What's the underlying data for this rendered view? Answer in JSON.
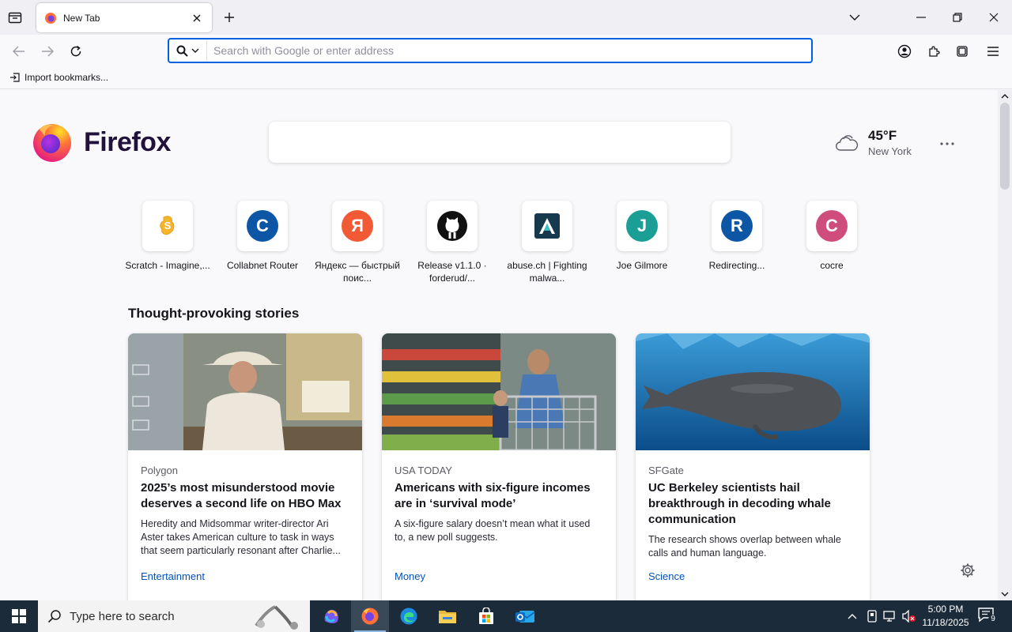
{
  "browser": {
    "tab": {
      "title": "New Tab"
    },
    "urlbar": {
      "placeholder": "Search with Google or enter address"
    },
    "bookmarks": {
      "import_label": "Import bookmarks..."
    }
  },
  "newtab": {
    "brand": "Firefox",
    "weather": {
      "temp": "45°F",
      "city": "New York"
    },
    "topsites": [
      {
        "label": "Scratch - Imagine,...",
        "letter": "",
        "color": "#f6b32c"
      },
      {
        "label": "Collabnet Router",
        "letter": "C",
        "color": "#0d56a6"
      },
      {
        "label": "Яндекс — быстрый поис...",
        "letter": "Я",
        "color": "#f25a36"
      },
      {
        "label": "Release v1.1.0 · forderud/...",
        "letter": "",
        "color": "#111111"
      },
      {
        "label": "abuse.ch | Fighting malwa...",
        "letter": "",
        "color": "#16394d"
      },
      {
        "label": "Joe Gilmore",
        "letter": "J",
        "color": "#1a9e96"
      },
      {
        "label": "Redirecting...",
        "letter": "R",
        "color": "#0d56a6"
      },
      {
        "label": "cocre",
        "letter": "C",
        "color": "#cf4d7c"
      }
    ],
    "stories_title": "Thought-provoking stories",
    "stories": [
      {
        "source": "Polygon",
        "title": "2025’s most misunderstood movie deserves a second life on HBO Max",
        "desc": "Heredity and Midsommar writer-director Ari Aster takes American culture to task in ways that seem particularly resonant after Charlie...",
        "category": "Entertainment"
      },
      {
        "source": "USA TODAY",
        "title": "Americans with six-figure incomes are in ‘survival mode’",
        "desc": "A six-figure salary doesn’t mean what it used to, a new poll suggests.",
        "category": "Money"
      },
      {
        "source": "SFGate",
        "title": "UC Berkeley scientists hail breakthrough in decoding whale communication",
        "desc": "The research shows overlap between whale calls and human language.",
        "category": "Science"
      }
    ]
  },
  "taskbar": {
    "search_placeholder": "Type here to search",
    "time": "5:00 PM",
    "date": "11/18/2025",
    "notification_count": "9"
  }
}
